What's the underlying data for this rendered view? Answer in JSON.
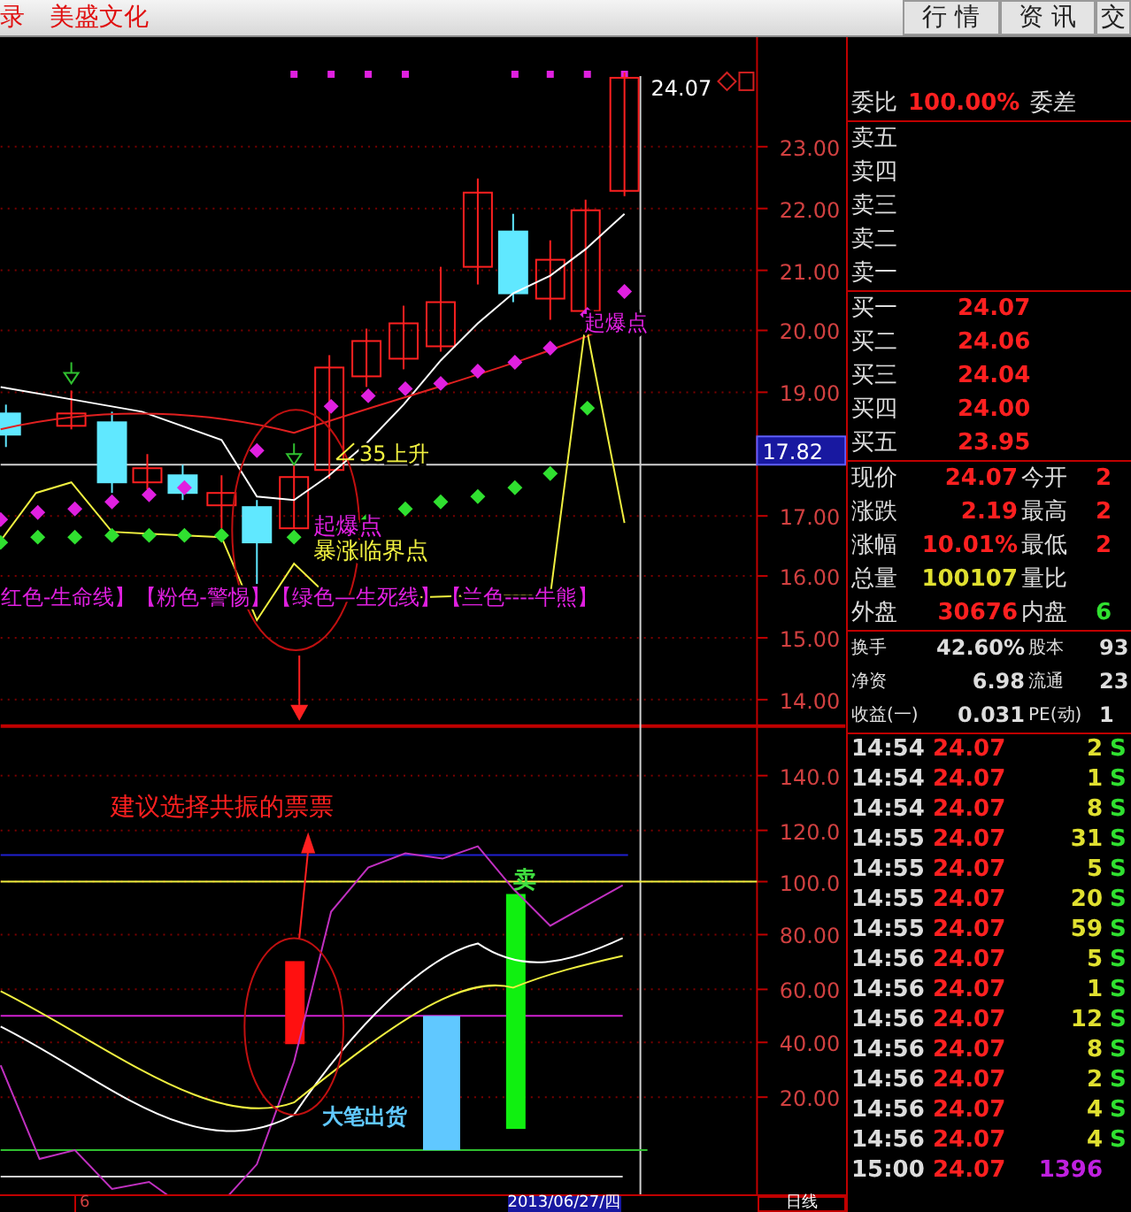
{
  "toolbar": {
    "items": [
      "录",
      "美盛文化"
    ],
    "tabs": [
      "行 情",
      "资 讯",
      "交"
    ]
  },
  "main_chart": {
    "last_price": "24.07",
    "price_axis": [
      "23.00",
      "22.00",
      "21.00",
      "20.00",
      "19.00",
      "17.00",
      "16.00",
      "15.00",
      "14.00"
    ],
    "current_marker": "17.82",
    "annotations": [
      {
        "text": "起爆点",
        "color": "#e020e0"
      },
      {
        "text": "35上升",
        "color": "#f0f040"
      },
      {
        "text": "起爆点",
        "color": "#e020e0"
      },
      {
        "text": "暴涨临界点",
        "color": "#f0f040"
      },
      {
        "text": "红色-生命线】【粉色-警惕】【绿色—生死线】【兰色----牛熊】",
        "color": "#e020e0"
      }
    ]
  },
  "indicator_chart": {
    "title": "建议选择共振的票票",
    "axis": [
      "140.0",
      "120.0",
      "100.0",
      "80.00",
      "60.00",
      "40.00",
      "20.00"
    ],
    "annotations": [
      {
        "text": "卖",
        "color": "#40e040"
      },
      {
        "text": "大笔出货",
        "color": "#60c8ff"
      }
    ]
  },
  "bottom_bar": {
    "marker": "6",
    "date": "2013/06/27/四",
    "period": "日线"
  },
  "quote_panel": {
    "order_ratio": {
      "label": "委比",
      "value": "100.00%",
      "label2": "委差"
    },
    "asks": [
      "卖五",
      "卖四",
      "卖三",
      "卖二",
      "卖一"
    ],
    "bids": [
      {
        "label": "买一",
        "price": "24.07"
      },
      {
        "label": "买二",
        "price": "24.06"
      },
      {
        "label": "买三",
        "price": "24.04"
      },
      {
        "label": "买四",
        "price": "24.00"
      },
      {
        "label": "买五",
        "price": "23.95"
      }
    ],
    "stats": [
      {
        "label": "现价",
        "value": "24.07",
        "color": "#ff2020"
      },
      {
        "label": "今开",
        "value": "2",
        "color": "#ff2020"
      },
      {
        "label": "涨跌",
        "value": "2.19",
        "color": "#ff2020"
      },
      {
        "label": "最高",
        "value": "2",
        "color": "#ff2020"
      },
      {
        "label": "涨幅",
        "value": "10.01%",
        "color": "#ff2020"
      },
      {
        "label": "最低",
        "value": "2",
        "color": "#ff2020"
      },
      {
        "label": "总量",
        "value": "100107",
        "color": "#e0e030"
      },
      {
        "label": "量比"
      },
      {
        "label": "外盘",
        "value": "30676",
        "color": "#ff2020"
      },
      {
        "label": "内盘",
        "value": "6",
        "color": "#30e030"
      }
    ],
    "fundamentals": [
      {
        "label": "换手",
        "value": "42.60%",
        "label2": "股本",
        "value2": "93"
      },
      {
        "label": "净资",
        "value": "6.98",
        "label2": "流通",
        "value2": "23"
      },
      {
        "label": "收益(一)",
        "value": "0.031",
        "label2": "PE(动)",
        "value2": "1"
      }
    ],
    "ticks": [
      {
        "time": "14:54",
        "price": "24.07",
        "volume": "2",
        "color": "#e0e030",
        "side": "S"
      },
      {
        "time": "14:54",
        "price": "24.07",
        "volume": "1",
        "color": "#e0e030",
        "side": "S"
      },
      {
        "time": "14:54",
        "price": "24.07",
        "volume": "8",
        "color": "#e0e030",
        "side": "S"
      },
      {
        "time": "14:55",
        "price": "24.07",
        "volume": "31",
        "color": "#e0e030",
        "side": "S"
      },
      {
        "time": "14:55",
        "price": "24.07",
        "volume": "5",
        "color": "#e0e030",
        "side": "S"
      },
      {
        "time": "14:55",
        "price": "24.07",
        "volume": "20",
        "color": "#e0e030",
        "side": "S"
      },
      {
        "time": "14:55",
        "price": "24.07",
        "volume": "59",
        "color": "#e0e030",
        "side": "S"
      },
      {
        "time": "14:56",
        "price": "24.07",
        "volume": "5",
        "color": "#e0e030",
        "side": "S"
      },
      {
        "time": "14:56",
        "price": "24.07",
        "volume": "1",
        "color": "#e0e030",
        "side": "S"
      },
      {
        "time": "14:56",
        "price": "24.07",
        "volume": "12",
        "color": "#e0e030",
        "side": "S"
      },
      {
        "time": "14:56",
        "price": "24.07",
        "volume": "8",
        "color": "#e0e030",
        "side": "S"
      },
      {
        "time": "14:56",
        "price": "24.07",
        "volume": "2",
        "color": "#e0e030",
        "side": "S"
      },
      {
        "time": "14:56",
        "price": "24.07",
        "volume": "4",
        "color": "#e0e030",
        "side": "S"
      },
      {
        "time": "14:56",
        "price": "24.07",
        "volume": "4",
        "color": "#e0e030",
        "side": "S"
      },
      {
        "time": "15:00",
        "price": "24.07",
        "volume": "1396",
        "color": "#c020e0"
      }
    ]
  }
}
